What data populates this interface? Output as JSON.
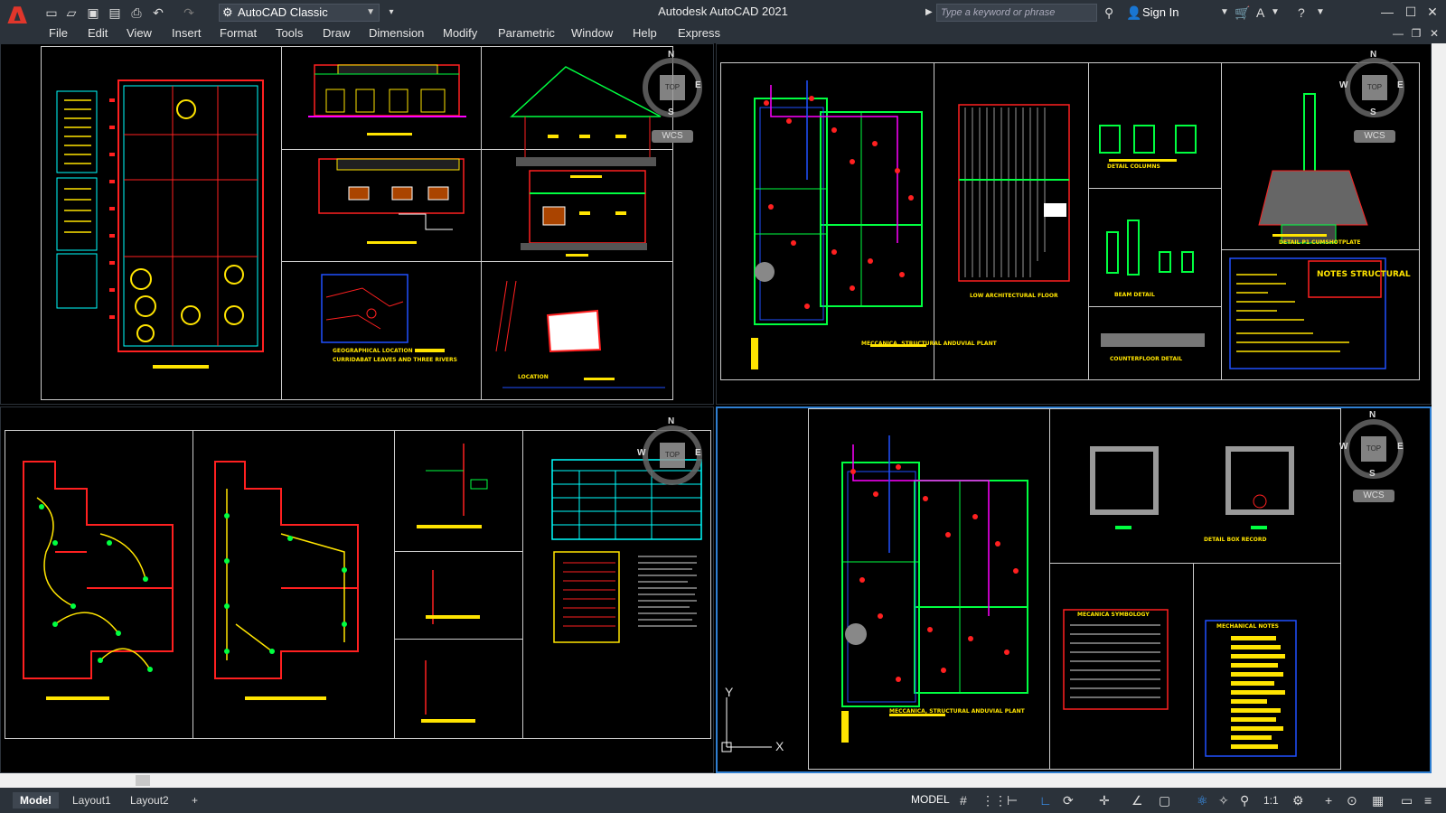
{
  "app": {
    "title": "Autodesk AutoCAD 2021",
    "logo_letter": "A",
    "workspace": "AutoCAD Classic",
    "search_placeholder": "Type a keyword or phrase",
    "sign_in": "Sign In"
  },
  "menu": [
    "File",
    "Edit",
    "View",
    "Insert",
    "Format",
    "Tools",
    "Draw",
    "Dimension",
    "Modify",
    "Parametric",
    "Window",
    "Help",
    "Express"
  ],
  "viewcube": {
    "n": "N",
    "s": "S",
    "e": "E",
    "w": "W",
    "top": "TOP",
    "wcs": "WCS"
  },
  "drawing_labels": {
    "geo_location": "GEOGRAPHICAL LOCATION",
    "geo_sub": "CURRIDABAT LEAVES AND THREE RIVERS",
    "location": "LOCATION",
    "plant_mech": "MECCANICA, STRUCTURAL ANDUVIAL PLANT",
    "low_arch": "LOW ARCHITECTURAL FLOOR",
    "detail_columns": "DETAIL COLUMNS",
    "beam_detail": "BEAM DETAIL",
    "counterfloor": "COUNTERFLOOR DETAIL",
    "detail_plate": "DETAIL P1 CUMSHOTPLATE",
    "notes_structural": "NOTES STRUCTURAL",
    "detail_box": "DETAIL BOX RECORD",
    "mech_symbology": "MECANICA SYMBOLOGY",
    "mech_notes": "MECHANICAL NOTES"
  },
  "axis": {
    "y": "Y",
    "x": "X"
  },
  "tabs": [
    "Model",
    "Layout1",
    "Layout2"
  ],
  "status": {
    "model": "MODEL",
    "scale": "1:1"
  },
  "colors": {
    "accent": "#2f7fd1",
    "cad_yellow": "#ffe400",
    "cad_red": "#ff2020",
    "cad_green": "#00ff40",
    "cad_cyan": "#00ffff",
    "cad_magenta": "#ff00ff"
  }
}
